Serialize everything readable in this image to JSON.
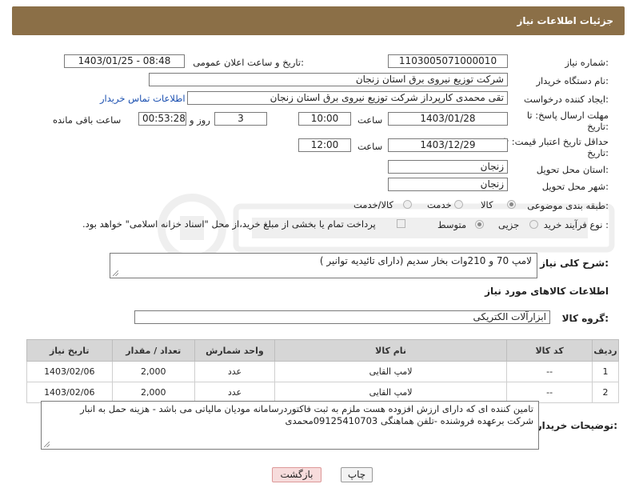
{
  "header": {
    "title": "جزئیات اطلاعات نیاز"
  },
  "fields": {
    "need_number_label": "شماره نیاز:",
    "need_number": "1103005071000010",
    "announce_label": "تاریخ و ساعت اعلان عمومی:",
    "announce_value": "1403/01/25 - 08:48",
    "buyer_org_label": "نام دستگاه خریدار:",
    "buyer_org": "شرکت توزیع نیروی برق استان زنجان",
    "creator_label": "ایجاد کننده درخواست:",
    "creator": "تقی محمدی کارپرداز شرکت توزیع نیروی برق استان زنجان",
    "contact_link": "اطلاعات تماس خریدار",
    "reply_deadline_label_1": "مهلت ارسال پاسخ: تا",
    "reply_deadline_label_2": "تاریخ:",
    "reply_date": "1403/01/28",
    "time_label": "ساعت",
    "reply_time": "10:00",
    "days_value": "3",
    "days_label": "روز و",
    "remaining_time": "00:53:28",
    "remaining_label": "ساعت باقی مانده",
    "price_validity_label_1": "حداقل تاریخ اعتبار قیمت: تا",
    "price_validity_label_2": "تاریخ:",
    "price_date": "1403/12/29",
    "price_time": "12:00",
    "province_label": "استان محل تحویل:",
    "province": "زنجان",
    "city_label": "شهر محل تحویل:",
    "city": "زنجان",
    "category_label": "طبقه بندی موضوعی:",
    "category_options": [
      "کالا",
      "خدمت",
      "کالا/خدمت"
    ],
    "process_label": "نوع فرآیند خرید :",
    "process_options": [
      "جزیی",
      "متوسط"
    ],
    "payment_note": "پرداخت تمام یا بخشی از مبلغ خرید،از محل \"اسناد خزانه اسلامی\" خواهد بود."
  },
  "description": {
    "label": "شرح کلی نیاز:",
    "text": "لامپ 70 و 210وات بخار سدیم (دارای تائیدیه توانیر )"
  },
  "goods": {
    "section_title": "اطلاعات کالاهای مورد نیاز",
    "group_label": "گروه کالا:",
    "group_value": "ابزارآلات الکتریکی",
    "columns": [
      "ردیف",
      "کد کالا",
      "نام کالا",
      "واحد شمارش",
      "تعداد / مقدار",
      "تاریخ نیاز"
    ],
    "rows": [
      [
        "1",
        "--",
        "لامپ القایی",
        "عدد",
        "2,000",
        "1403/02/06"
      ],
      [
        "2",
        "--",
        "لامپ القایی",
        "عدد",
        "2,000",
        "1403/02/06"
      ]
    ]
  },
  "buyer_notes": {
    "label": "توضیحات خریدار:",
    "line1": "تامین کننده ای که دارای ارزش افزوده هست ملزم به ثبت فاکتوردرسامانه مودیان مالیاتی می باشد  - هزینه حمل به انبار",
    "line2": "شرکت برعهده فروشنده -تلفن هماهنگی 09125410703محمدی"
  },
  "buttons": {
    "print": "چاپ",
    "back": "بازگشت"
  },
  "colors": {
    "header": "#8b6f47",
    "link": "#1a4fb0",
    "back_button_bg": "#f7dcdc"
  }
}
